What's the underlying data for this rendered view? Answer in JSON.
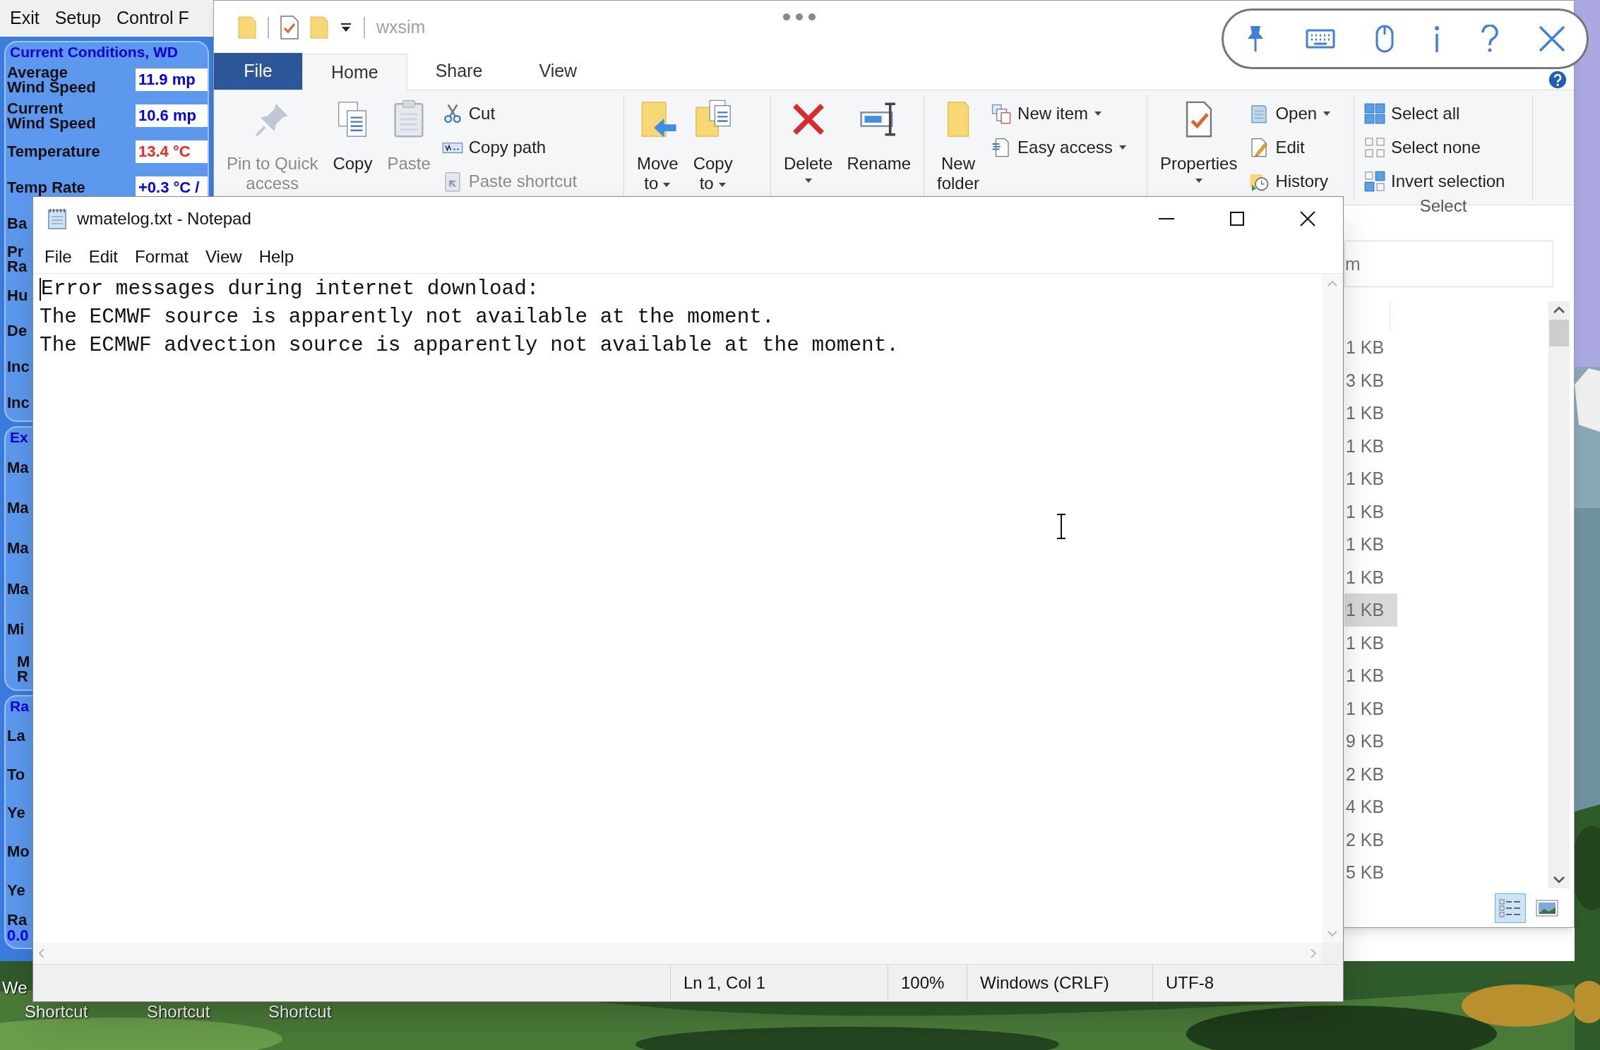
{
  "weather_app": {
    "menu": [
      "Exit",
      "Setup",
      "Control F"
    ],
    "sections": [
      {
        "title": "Current Conditions, WD",
        "rows": [
          {
            "kind": "value",
            "label": "Average\nWind Speed",
            "value": "11.9 mp",
            "color": "#0000ff"
          },
          {
            "kind": "value",
            "label": "Current\nWind Speed",
            "value": "10.6 mp",
            "color": "#0000ff"
          },
          {
            "kind": "value",
            "label": "Temperature",
            "value": "13.4 °C",
            "color": "#ff2020"
          },
          {
            "kind": "value",
            "label": "Temp Rate",
            "value": "+0.3 °C /",
            "color": "#0000ff"
          },
          {
            "kind": "plain",
            "label": "Ba"
          },
          {
            "kind": "plain",
            "label": "Pr\nRa"
          },
          {
            "kind": "plain",
            "label": "Hu"
          },
          {
            "kind": "plain",
            "label": "De"
          },
          {
            "kind": "plain",
            "label": "Inc"
          },
          {
            "kind": "plain",
            "label": "Inc"
          }
        ]
      },
      {
        "title": "Ex",
        "rows": [
          {
            "kind": "plain",
            "label": "Ma"
          },
          {
            "kind": "plain",
            "label": "Ma"
          },
          {
            "kind": "plain",
            "label": "Ma"
          },
          {
            "kind": "plain",
            "label": "Ma"
          },
          {
            "kind": "plain",
            "label": "Mi"
          },
          {
            "kind": "sub",
            "label": "M\nR"
          }
        ]
      },
      {
        "title": "Ra",
        "rows": [
          {
            "kind": "plain",
            "label": "La"
          },
          {
            "kind": "plain",
            "label": "To"
          },
          {
            "kind": "plain",
            "label": "Ye"
          },
          {
            "kind": "plain",
            "label": "Mo"
          },
          {
            "kind": "plain",
            "label": "Ye"
          },
          {
            "kind": "stacked",
            "label": "Ra",
            "value": "0.0",
            "color": "#0000ff"
          }
        ]
      }
    ]
  },
  "explorer": {
    "title": "wxsim",
    "tabs": [
      {
        "label": "File",
        "kind": "file",
        "selected": false
      },
      {
        "label": "Home",
        "kind": "tab",
        "selected": true
      },
      {
        "label": "Share",
        "kind": "tab",
        "selected": false
      },
      {
        "label": "View",
        "kind": "tab",
        "selected": false
      }
    ],
    "ribbon": {
      "groups": [
        {
          "large": [
            {
              "kind": "pin",
              "lines": [
                "Pin to Quick",
                "access"
              ],
              "disabled": true,
              "dropdown": false
            },
            {
              "kind": "copy",
              "lines": [
                "Copy"
              ],
              "disabled": false,
              "dropdown": false
            },
            {
              "kind": "paste",
              "lines": [
                "Paste"
              ],
              "disabled": true,
              "dropdown": false
            }
          ],
          "small": [
            {
              "kind": "cut",
              "label": "Cut",
              "disabled": false,
              "dropdown": false
            },
            {
              "kind": "copypath",
              "label": "Copy path",
              "disabled": false,
              "dropdown": false
            },
            {
              "kind": "pasteshortcut",
              "label": "Paste shortcut",
              "disabled": true,
              "dropdown": false
            }
          ]
        },
        {
          "large": [
            {
              "kind": "move",
              "lines": [
                "Move",
                "to"
              ],
              "disabled": false,
              "dropdown": true
            },
            {
              "kind": "copyto",
              "lines": [
                "Copy",
                "to"
              ],
              "disabled": false,
              "dropdown": true
            }
          ]
        },
        {
          "large": [
            {
              "kind": "delete",
              "lines": [
                "Delete"
              ],
              "disabled": false,
              "dropdown": true
            },
            {
              "kind": "rename",
              "lines": [
                "Rename"
              ],
              "disabled": false,
              "dropdown": false
            }
          ]
        },
        {
          "large": [
            {
              "kind": "folder",
              "lines": [
                "New",
                "folder"
              ],
              "disabled": false,
              "dropdown": false
            }
          ],
          "small": [
            {
              "kind": "newitem",
              "label": "New item",
              "disabled": false,
              "dropdown": true
            },
            {
              "kind": "easyaccess",
              "label": "Easy access",
              "disabled": false,
              "dropdown": true
            }
          ]
        },
        {
          "large": [
            {
              "kind": "properties",
              "lines": [
                "Properties"
              ],
              "disabled": false,
              "dropdown": true
            }
          ],
          "small": [
            {
              "kind": "open",
              "label": "Open",
              "disabled": false,
              "dropdown": true
            },
            {
              "kind": "edit",
              "label": "Edit",
              "disabled": false,
              "dropdown": false
            },
            {
              "kind": "history",
              "label": "History",
              "disabled": false,
              "dropdown": false
            }
          ]
        },
        {
          "label": "Select",
          "small": [
            {
              "kind": "selectall",
              "label": "Select all",
              "disabled": false,
              "dropdown": false
            },
            {
              "kind": "selectnone",
              "label": "Select none",
              "disabled": false,
              "dropdown": false
            },
            {
              "kind": "invert",
              "label": "Invert selection",
              "disabled": false,
              "dropdown": false
            }
          ]
        }
      ]
    },
    "search": {
      "placeholder": "m"
    },
    "files": [
      {
        "size": "1 KB",
        "selected": false
      },
      {
        "size": "3 KB",
        "selected": false
      },
      {
        "size": "1 KB",
        "selected": false
      },
      {
        "size": "1 KB",
        "selected": false
      },
      {
        "size": "1 KB",
        "selected": false
      },
      {
        "size": "1 KB",
        "selected": false
      },
      {
        "size": "1 KB",
        "selected": false
      },
      {
        "size": "1 KB",
        "selected": false
      },
      {
        "size": "1 KB",
        "selected": true
      },
      {
        "size": "1 KB",
        "selected": false
      },
      {
        "size": "1 KB",
        "selected": false
      },
      {
        "size": "1 KB",
        "selected": false
      },
      {
        "size": "9 KB",
        "selected": false
      },
      {
        "size": "2 KB",
        "selected": false
      },
      {
        "size": "4 KB",
        "selected": false
      },
      {
        "size": "2 KB",
        "selected": false
      },
      {
        "size": "5 KB",
        "selected": false
      }
    ],
    "view_buttons": [
      {
        "kind": "details",
        "selected": true
      },
      {
        "kind": "large",
        "selected": false
      }
    ]
  },
  "notepad": {
    "title": "wmatelog.txt - Notepad",
    "menu": [
      "File",
      "Edit",
      "Format",
      "View",
      "Help"
    ],
    "lines": [
      "Error messages during internet download:",
      "The ECMWF source is apparently not available at the moment.",
      "The ECMWF advection source is apparently not available at the moment."
    ],
    "status": [
      "Ln 1, Col 1",
      "100%",
      "Windows (CRLF)",
      "UTF-8"
    ]
  },
  "desktop": {
    "labels": [
      "We",
      "Shortcut",
      "Shortcut",
      "Shortcut"
    ]
  }
}
